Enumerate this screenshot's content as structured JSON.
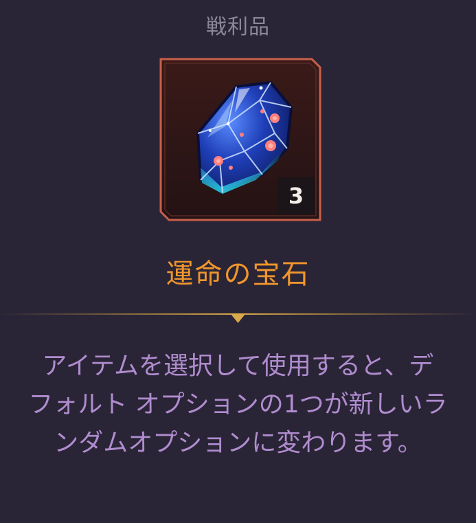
{
  "header": {
    "title": "戦利品"
  },
  "item": {
    "name": "運命の宝石",
    "quantity": "3",
    "icon": "gem-icon",
    "rarity_color": "#c8604a"
  },
  "description": {
    "lines": [
      "アイテムを選択して使用すると、デ",
      "フォルト オプションの1つが新しいラ",
      "ンダムオプションに変わります。"
    ]
  },
  "colors": {
    "background": "#2a2536",
    "item_name": "#f0962d",
    "description": "#b08ccf",
    "divider": "#c89a3c"
  }
}
